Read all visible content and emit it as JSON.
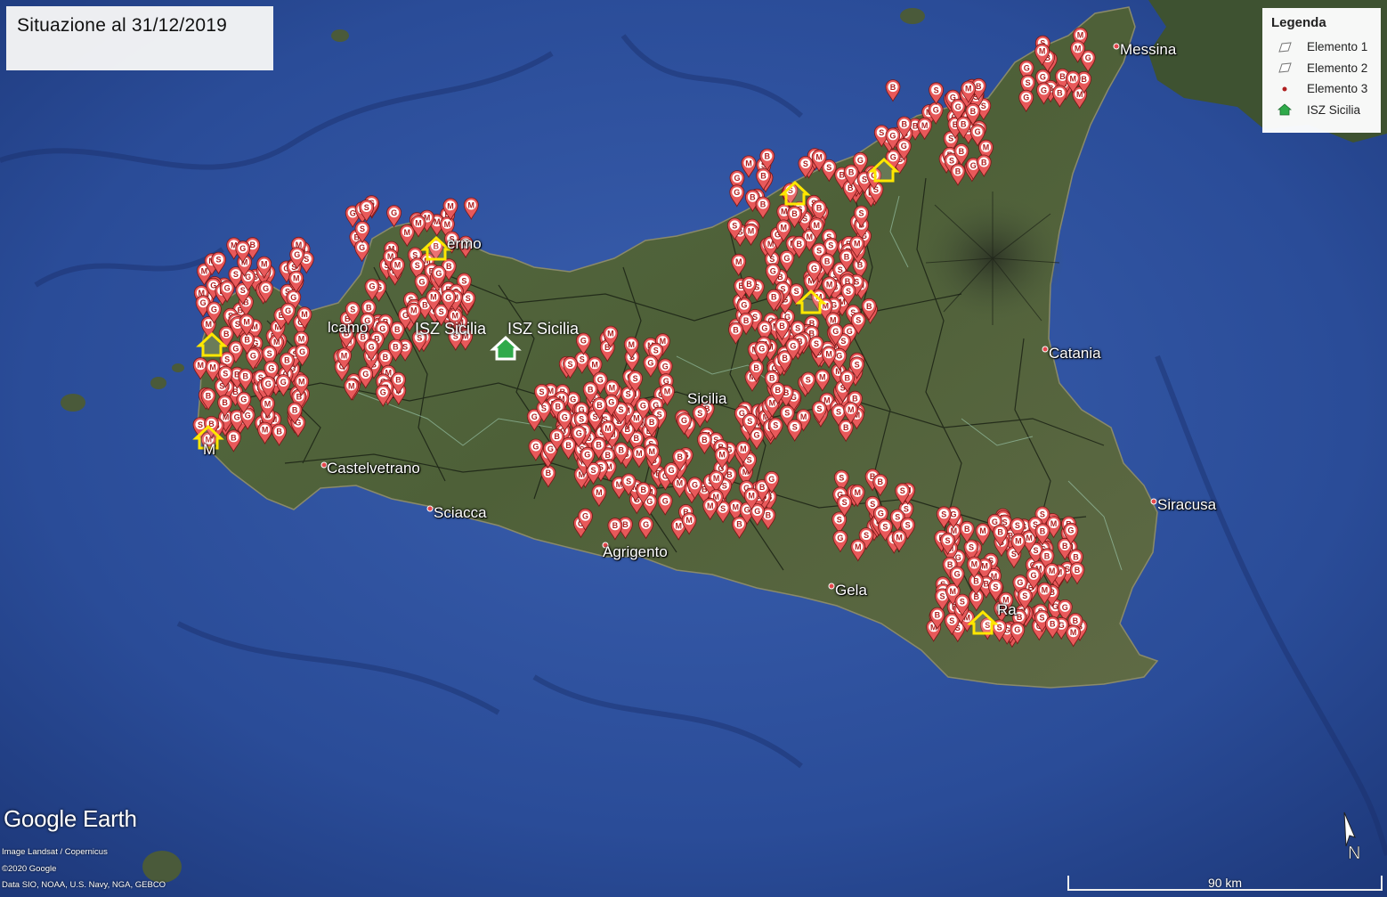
{
  "title": "Situazione al 31/12/2019",
  "legend": {
    "title": "Legenda",
    "items": [
      {
        "label": "Elemento 1",
        "icon": "polygon-outline-icon"
      },
      {
        "label": "Elemento 2",
        "icon": "polygon-outline-icon"
      },
      {
        "label": "Elemento 3",
        "icon": "red-dot-icon"
      },
      {
        "label": "ISZ Sicilia",
        "icon": "green-house-icon"
      }
    ]
  },
  "cities": [
    {
      "name": "Messina"
    },
    {
      "name": "Catania"
    },
    {
      "name": "Siracusa"
    },
    {
      "name": "Gela"
    },
    {
      "name": "Sciacca"
    },
    {
      "name": "Castelvetrano"
    },
    {
      "name": "Sicilia"
    },
    {
      "name": "Agrigento"
    },
    {
      "name": "lcamo"
    },
    {
      "name": "ermo"
    },
    {
      "name": "M"
    },
    {
      "name": "Ra"
    }
  ],
  "isz_labels": [
    "ISZ Sicilia",
    "ISZ Sicilia"
  ],
  "marker_letters": [
    "M",
    "S",
    "G",
    "B"
  ],
  "colors": {
    "marker": "#e8595a",
    "house_outline": "#ffe700",
    "house_green": "#2faa4a",
    "sea": "#1e3f86",
    "land": "#4b5f3b"
  },
  "branding": {
    "logo": "Google Earth",
    "attribution": [
      "Image Landsat / Copernicus",
      "©2020 Google",
      "Data SIO, NOAA, U.S. Navy, NGA, GEBCO"
    ]
  },
  "scale_label": "90 km",
  "compass": "N"
}
